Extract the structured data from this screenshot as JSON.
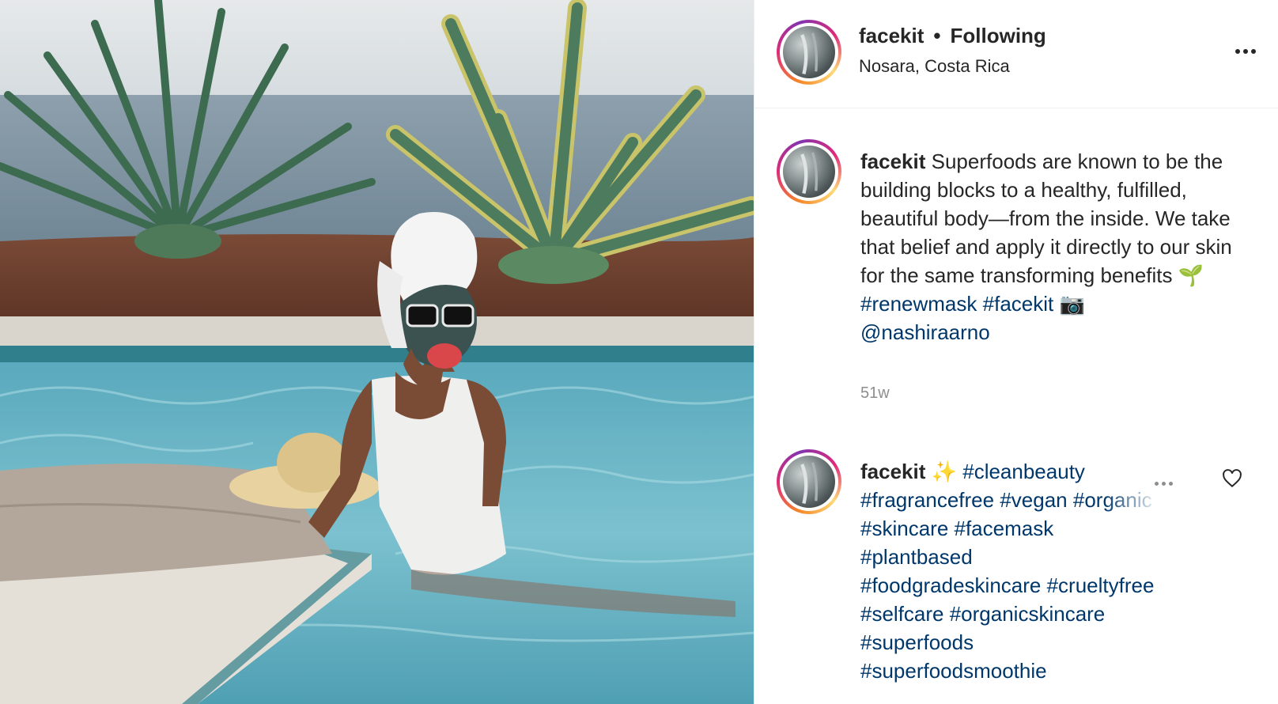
{
  "photo": {
    "alt_icon": "post-photo"
  },
  "header": {
    "username": "facekit",
    "separator": "•",
    "follow_status": "Following",
    "location": "Nosara, Costa Rica",
    "more_icon": "more-horizontal-icon"
  },
  "caption": {
    "username": "facekit",
    "text": "Superfoods are known to be the building blocks to a healthy, fulfilled, beautiful body—from the inside. We take that belief and apply it directly to our skin for the same transforming benefits 🌱",
    "tags": [
      "#renewmask",
      "#facekit"
    ],
    "camera_emoji": "📷",
    "mention": "@nashiraarno",
    "time": "51w"
  },
  "comment": {
    "username": "facekit",
    "sparkle": "✨",
    "tags_line1": "#cleanbeauty",
    "tags_line2_a": "#fragrancefree #vegan",
    "tags_line2_b": "#organic",
    "tags_line3": "#skincare #facemask",
    "tags_line4": "#plantbased",
    "tags_line5": "#foodgradeskincare #crueltyfree",
    "tags_line6": "#selfcare #organicskincare",
    "tags_line7": "#superfoods",
    "tags_line8": "#superfoodsmoothie"
  },
  "colors": {
    "link": "#00376b",
    "text": "#262626",
    "muted": "#8e8e8e"
  }
}
